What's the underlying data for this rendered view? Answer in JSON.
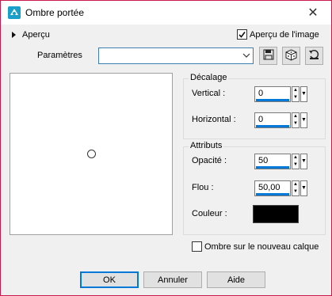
{
  "window": {
    "title": "Ombre portée"
  },
  "preview_toggle": {
    "label": "Aperçu"
  },
  "image_preview": {
    "label": "Aperçu de l'image",
    "checked": true
  },
  "params": {
    "label": "Paramètres",
    "value": ""
  },
  "offset": {
    "title": "Décalage",
    "vertical": {
      "label": "Vertical :",
      "value": "0"
    },
    "horizontal": {
      "label": "Horizontal :",
      "value": "0"
    }
  },
  "attributes": {
    "title": "Attributs",
    "opacity": {
      "label": "Opacité :",
      "value": "50"
    },
    "blur": {
      "label": "Flou :",
      "value": "50,00"
    },
    "color": {
      "label": "Couleur :",
      "value": "#000000"
    }
  },
  "new_layer": {
    "label": "Ombre sur le nouveau calque",
    "checked": false
  },
  "buttons": {
    "ok": "OK",
    "cancel": "Annuler",
    "help": "Aide"
  }
}
